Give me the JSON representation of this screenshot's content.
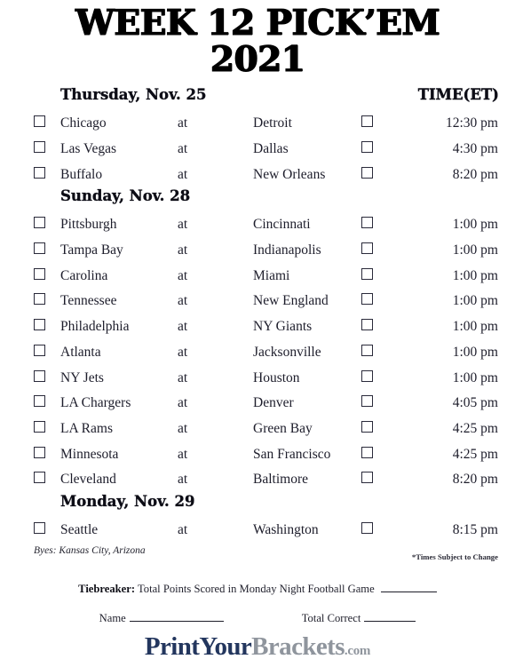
{
  "title": {
    "line1": "WEEK 12 PICK’EM",
    "line2": "2021"
  },
  "columns": {
    "time_header": "TIME(ET)",
    "at_label": "at"
  },
  "days": [
    {
      "header": "Thursday, Nov. 25",
      "games": [
        {
          "home": "Chicago",
          "at": "at",
          "away": "Detroit",
          "time": "12:30 pm"
        },
        {
          "home": "Las Vegas",
          "at": "at",
          "away": "Dallas",
          "time": "4:30 pm"
        },
        {
          "home": "Buffalo",
          "at": "at",
          "away": "New Orleans",
          "time": "8:20 pm"
        }
      ]
    },
    {
      "header": "Sunday, Nov. 28",
      "games": [
        {
          "home": "Pittsburgh",
          "at": "at",
          "away": "Cincinnati",
          "time": "1:00 pm"
        },
        {
          "home": "Tampa Bay",
          "at": "at",
          "away": "Indianapolis",
          "time": "1:00 pm"
        },
        {
          "home": "Carolina",
          "at": "at",
          "away": "Miami",
          "time": "1:00 pm"
        },
        {
          "home": "Tennessee",
          "at": "at",
          "away": "New England",
          "time": "1:00 pm"
        },
        {
          "home": "Philadelphia",
          "at": "at",
          "away": "NY Giants",
          "time": "1:00 pm"
        },
        {
          "home": "Atlanta",
          "at": "at",
          "away": "Jacksonville",
          "time": "1:00 pm"
        },
        {
          "home": "NY Jets",
          "at": "at",
          "away": "Houston",
          "time": "1:00 pm"
        },
        {
          "home": "LA Chargers",
          "at": "at",
          "away": "Denver",
          "time": "4:05 pm"
        },
        {
          "home": "LA Rams",
          "at": "at",
          "away": "Green Bay",
          "time": "4:25 pm"
        },
        {
          "home": "Minnesota",
          "at": "at",
          "away": "San Francisco",
          "time": "4:25 pm"
        },
        {
          "home": "Cleveland",
          "at": "at",
          "away": "Baltimore",
          "time": "8:20 pm"
        }
      ]
    },
    {
      "header": "Monday, Nov. 29",
      "games": [
        {
          "home": "Seattle",
          "at": "at",
          "away": "Washington",
          "time": "8:15 pm"
        }
      ]
    }
  ],
  "notes": {
    "byes": "Byes: Kansas City, Arizona",
    "subject_to_change": "*Times Subject to Change"
  },
  "footer": {
    "tiebreaker_label": "Tiebreaker:",
    "tiebreaker_text": "Total Points Scored in Monday Night Football Game",
    "name_label": "Name",
    "total_correct_label": "Total Correct"
  },
  "logo": {
    "part1": "PrintYour",
    "part2": "Brackets",
    "part3": ".com",
    "color_navy": "#23365e",
    "color_gray": "#8f959d"
  }
}
